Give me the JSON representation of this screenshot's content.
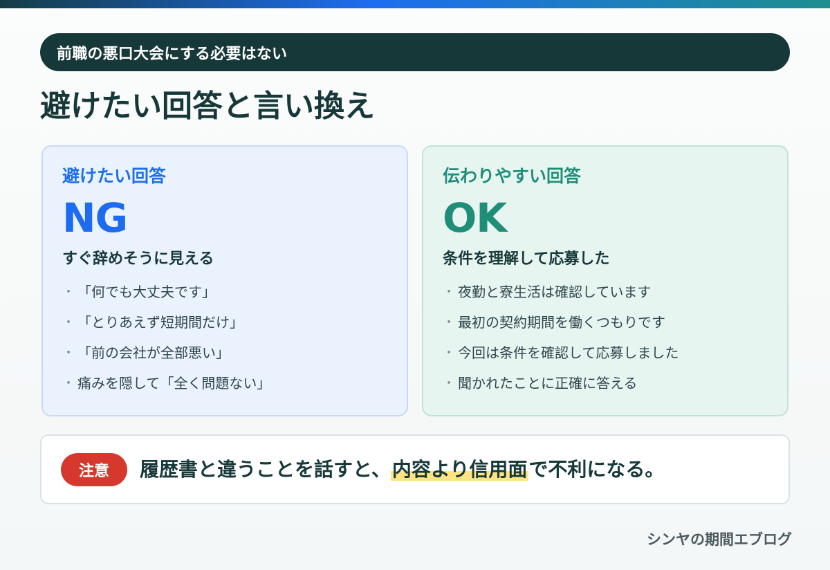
{
  "banner": {
    "text": "前職の悪口大会にする必要はない"
  },
  "page_title": "避けたい回答と言い換え",
  "cards": {
    "ng": {
      "label": "避けたい回答",
      "big": "NG",
      "sub": "すぐ辞めそうに見える",
      "bullets": [
        "「何でも大丈夫です」",
        "「とりあえず短期間だけ」",
        "「前の会社が全部悪い」",
        "痛みを隠して「全く問題ない」"
      ]
    },
    "ok": {
      "label": "伝わりやすい回答",
      "big": "OK",
      "sub": "条件を理解して応募した",
      "bullets": [
        "夜勤と寮生活は確認しています",
        "最初の契約期間を働くつもりです",
        "今回は条件を確認して応募しました",
        "聞かれたことに正確に答える"
      ]
    }
  },
  "note": {
    "badge": "注意",
    "text_before": "履歴書と違うことを話すと、",
    "text_highlight": "内容より信用面",
    "text_after": "で不利になる。"
  },
  "footer": "シンヤの期間エブログ",
  "colors": {
    "banner": "#173839",
    "ng_accent": "#1d6bf0",
    "ok_accent": "#1f8e79",
    "badge": "#d6382d",
    "highlight": "#ffe481"
  }
}
